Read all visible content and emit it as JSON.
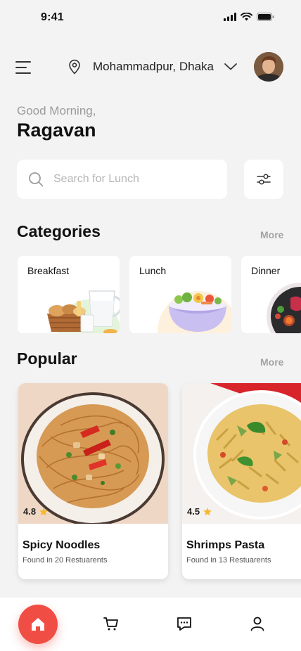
{
  "status_bar": {
    "time": "9:41"
  },
  "header": {
    "location": "Mohammadpur, Dhaka"
  },
  "greeting": {
    "salutation": "Good Morning,",
    "name": "Ragavan"
  },
  "search": {
    "placeholder": "Search for Lunch",
    "value": ""
  },
  "categories": {
    "title": "Categories",
    "more_label": "More",
    "items": [
      {
        "label": "Breakfast"
      },
      {
        "label": "Lunch"
      },
      {
        "label": "Dinner"
      }
    ]
  },
  "popular": {
    "title": "Popular",
    "more_label": "More",
    "items": [
      {
        "rating": "4.8",
        "title": "Spicy Noodles",
        "subtitle": "Found in 20 Restuarents"
      },
      {
        "rating": "4.5",
        "title": "Shrimps Pasta",
        "subtitle": "Found in 13 Restuarents"
      }
    ]
  },
  "colors": {
    "accent": "#f04e45",
    "star": "#f5b82e",
    "background": "#f3f3f3"
  },
  "icons": [
    "signal-icon",
    "wifi-icon",
    "battery-icon",
    "menu-icon",
    "location-pin-icon",
    "chevron-down-icon",
    "search-icon",
    "filter-icon",
    "star-icon",
    "home-icon",
    "cart-icon",
    "chat-icon",
    "profile-icon"
  ]
}
